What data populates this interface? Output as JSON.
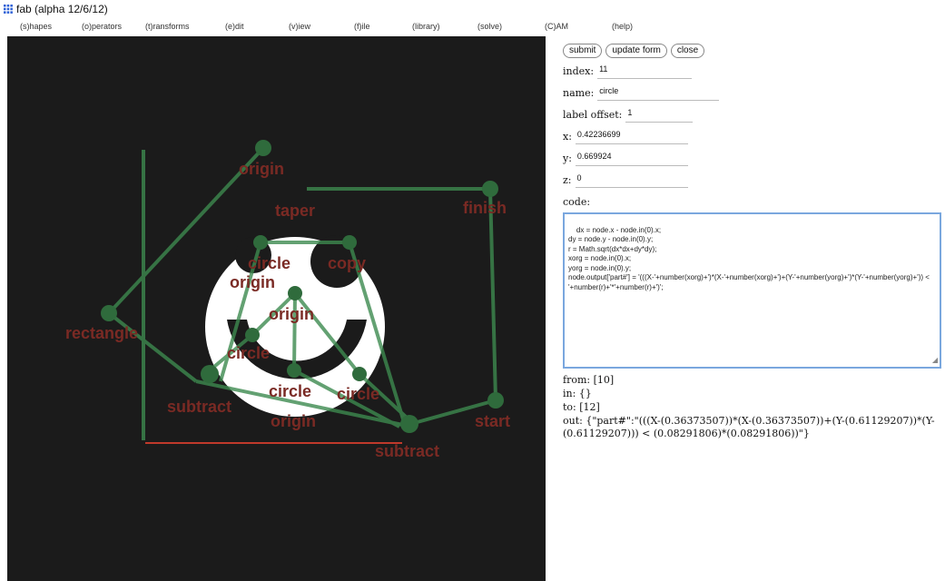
{
  "window": {
    "title": "fab (alpha 12/6/12)",
    "icon": "grid-icon"
  },
  "menu": [
    "(s)hapes",
    "(o)perators",
    "(t)ransforms",
    "(e)dit",
    "(v)iew",
    "(f)ile",
    "(library)",
    "(solve)",
    "(C)AM",
    "(help)"
  ],
  "colors": {
    "canvas_bg": "#1b1b1b",
    "node_green": "#2f6b3c",
    "edge_green": "#3d8a4f",
    "label_red": "#7a2a24",
    "baseline_red": "#c0392b"
  },
  "canvas": {
    "labels": [
      "origin",
      "taper",
      "finish",
      "circle",
      "copy",
      "origin",
      "origin",
      "rectangle",
      "circle",
      "circle",
      "circle",
      "subtract",
      "origin",
      "start",
      "subtract"
    ]
  },
  "form": {
    "buttons": [
      "submit",
      "update form",
      "close"
    ],
    "index_label": "index:",
    "index_value": "11",
    "name_label": "name:",
    "name_value": "circle",
    "label_offset_label": "label offset:",
    "label_offset_value": "1",
    "x_label": "x:",
    "x_value": "0.42236699",
    "y_label": "y:",
    "y_value": "0.669924",
    "z_label": "z:",
    "z_value": "0",
    "code_label": "code:",
    "code": "dx = node.x - node.in(0).x;\ndy = node.y - node.in(0).y;\nr = Math.sqrt(dx*dx+dy*dy);\nxorg = node.in(0).x;\nyorg = node.in(0).y;\nnode.output['part#'] = '(((X-'+number(xorg)+')*(X-'+number(xorg)+')+(Y-'+number(yorg)+')*(Y-'+number(yorg)+')) < '+number(r)+'*'+number(r)+')';",
    "from": "from: [10]",
    "in": "in: {}",
    "to": "to: [12]",
    "out": "out: {\"part#\":\"(((X-(0.36373507))*(X-(0.36373507))+(Y-(0.61129207))*(Y-(0.61129207))) < (0.08291806)*(0.08291806))\"}"
  }
}
